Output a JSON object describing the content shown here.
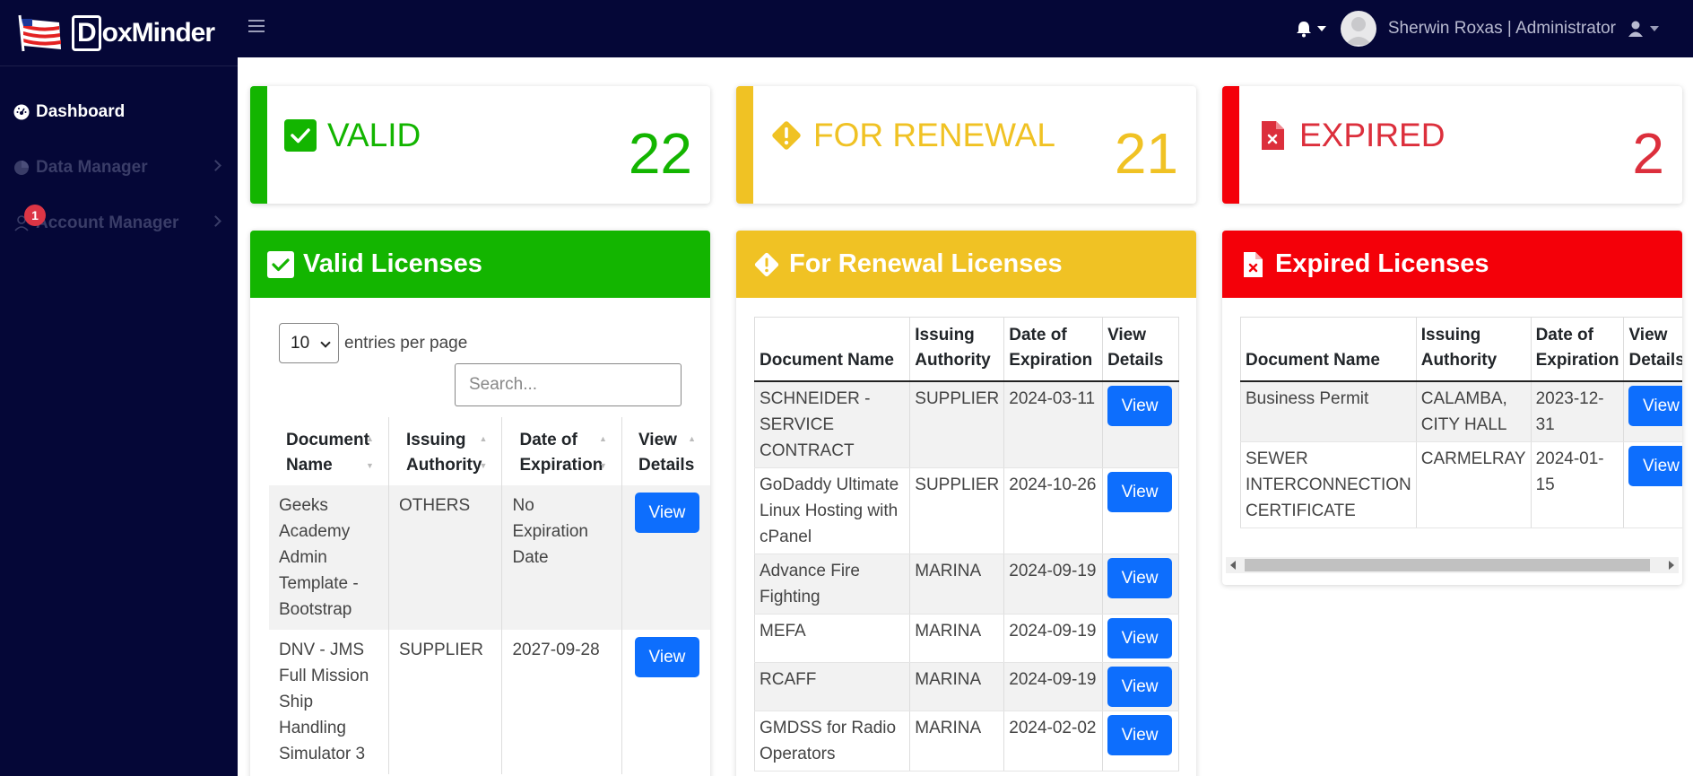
{
  "brand": {
    "name": "DoxMinder"
  },
  "sidebar": {
    "items": [
      {
        "label": "Dashboard",
        "icon": "dashboard-icon"
      },
      {
        "label": "Data Manager",
        "icon": "pie-chart-icon"
      },
      {
        "label": "Account Manager",
        "icon": "user-icon",
        "badge": "1"
      }
    ]
  },
  "topbar": {
    "user": "Sherwin Roxas | Administrator"
  },
  "stats": {
    "valid": {
      "label": "VALID",
      "value": "22",
      "color": "#13b500"
    },
    "renewal": {
      "label": "FOR RENEWAL",
      "value": "21",
      "color": "#f0c224"
    },
    "expired": {
      "label": "EXPIRED",
      "value": "2",
      "color": "#dc2f3c"
    }
  },
  "valid_panel": {
    "title": "Valid Licenses",
    "entries_value": "10",
    "entries_label": "entries per page",
    "search_placeholder": "Search...",
    "columns": [
      "Document Name",
      "Issuing Authority",
      "Date of Expiration",
      "View Details"
    ],
    "rows": [
      {
        "name": "Geeks Academy Admin Template - Bootstrap",
        "authority": "OTHERS",
        "date": "No Expiration Date",
        "action": "View"
      },
      {
        "name": "DNV - JMS Full Mission Ship Handling Simulator 3",
        "authority": "SUPPLIER",
        "date": "2027-09-28",
        "action": "View"
      }
    ]
  },
  "renewal_panel": {
    "title": "For Renewal Licenses",
    "columns": [
      "Document Name",
      "Issuing Authority",
      "Date of Expiration",
      "View Details"
    ],
    "rows": [
      {
        "name": "SCHNEIDER - SERVICE CONTRACT",
        "authority": "SUPPLIER",
        "date": "2024-03-11",
        "action": "View"
      },
      {
        "name": "GoDaddy Ultimate Linux Hosting with cPanel",
        "authority": "SUPPLIER",
        "date": "2024-10-26",
        "action": "View"
      },
      {
        "name": "Advance Fire Fighting",
        "authority": "MARINA",
        "date": "2024-09-19",
        "action": "View"
      },
      {
        "name": "MEFA",
        "authority": "MARINA",
        "date": "2024-09-19",
        "action": "View"
      },
      {
        "name": "RCAFF",
        "authority": "MARINA",
        "date": "2024-09-19",
        "action": "View"
      },
      {
        "name": "GMDSS for Radio Operators",
        "authority": "MARINA",
        "date": "2024-02-02",
        "action": "View"
      }
    ]
  },
  "expired_panel": {
    "title": "Expired Licenses",
    "columns": [
      "Document Name",
      "Issuing Authority",
      "Date of Expiration",
      "View Details"
    ],
    "rows": [
      {
        "name": "Business Permit",
        "authority": "CALAMBA, CITY HALL",
        "date": "2023-12-31",
        "action": "View"
      },
      {
        "name": "SEWER INTERCONNECTION CERTIFICATE",
        "authority": "CARMELRAY",
        "date": "2024-01-15",
        "action": "View"
      }
    ]
  }
}
